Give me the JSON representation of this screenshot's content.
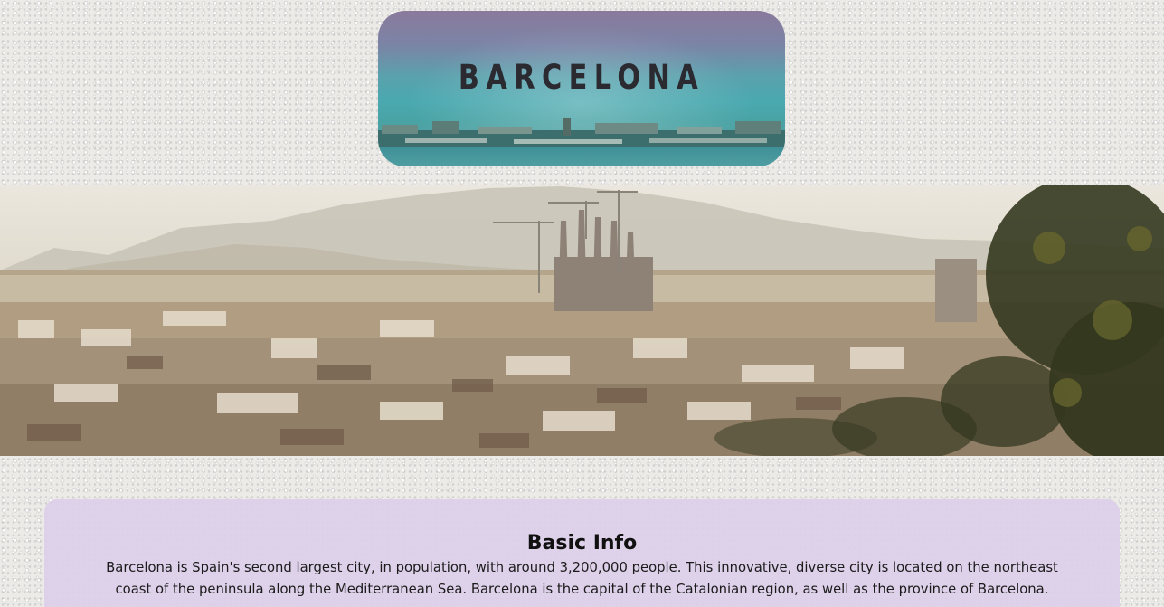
{
  "header": {
    "title": "BARCELONA"
  },
  "hero_image": {
    "subject": "Barcelona city skyline panorama with Sagrada Familia"
  },
  "basic_info": {
    "heading": "Basic Info",
    "line1": "Barcelona is Spain's second largest city, in population, with around 3,200,000 people. This innovative, diverse city is located on the northeast",
    "line2": "coast of the peninsula along the Mediterranean Sea. Barcelona is the capital of the Catalonian region, as well as the province of Barcelona."
  },
  "colors": {
    "page_background": "#ecebe8",
    "info_card": "#ddcfea",
    "title_text": "#2a2a30"
  }
}
